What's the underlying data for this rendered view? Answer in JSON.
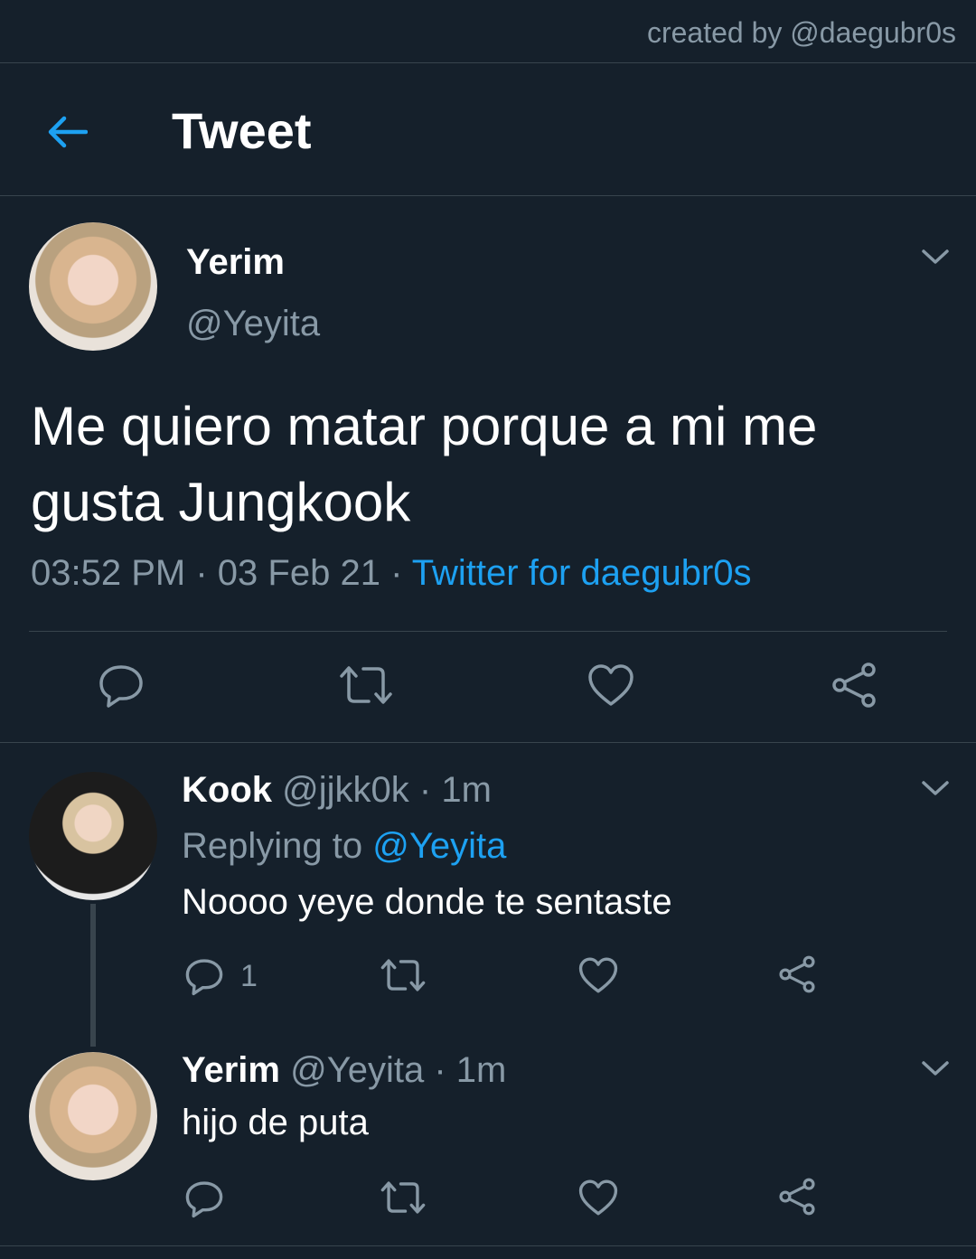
{
  "credit": "created by @daegubr0s",
  "header": {
    "title": "Tweet"
  },
  "main_tweet": {
    "name": "Yerim",
    "handle": "@Yeyita",
    "text": "Me quiero matar porque a mi me gusta Jungkook",
    "time": "03:52 PM",
    "date": "03 Feb 21",
    "sep": "·",
    "source": "Twitter for daegubr0s"
  },
  "reply1": {
    "name": "Kook",
    "handle": "@jjkk0k",
    "ago": "1m",
    "sep": "·",
    "replying_prefix": "Replying to",
    "replying_handle": "@Yeyita",
    "text": "Noooo yeye donde te sentaste",
    "reply_count": "1"
  },
  "reply2": {
    "name": "Yerim",
    "handle": "@Yeyita",
    "ago": "1m",
    "sep": "·",
    "text": "hijo de puta"
  },
  "icons": [
    "back-arrow-icon",
    "chevron-down-icon",
    "reply-icon",
    "retweet-icon",
    "like-icon",
    "share-icon"
  ],
  "colors": {
    "background": "#15202b",
    "accent": "#1da1f2",
    "muted": "#8899a6",
    "divider": "#38444d"
  }
}
